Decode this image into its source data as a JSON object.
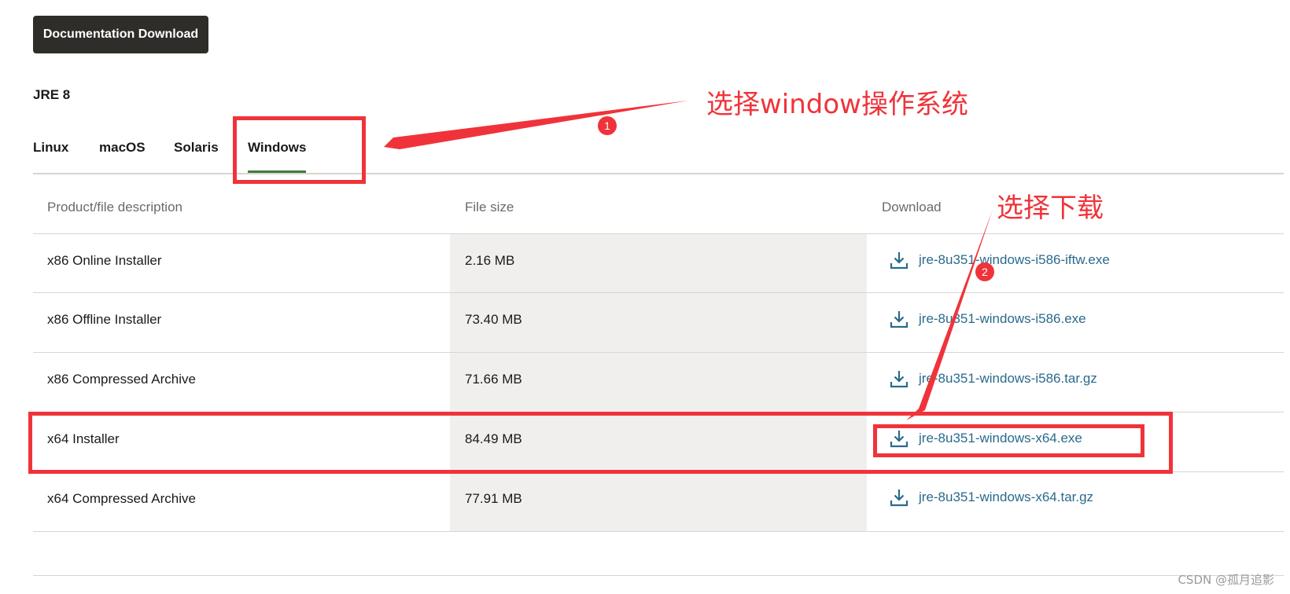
{
  "header": {
    "doc_button": "Documentation Download"
  },
  "section": {
    "title": "JRE 8"
  },
  "tabs": [
    {
      "label": "Linux",
      "active": false
    },
    {
      "label": "macOS",
      "active": false
    },
    {
      "label": "Solaris",
      "active": false
    },
    {
      "label": "Windows",
      "active": true
    }
  ],
  "table": {
    "headers": [
      "Product/file description",
      "File size",
      "Download"
    ],
    "rows": [
      {
        "description": "x86 Online Installer",
        "size": "2.16 MB",
        "file": "jre-8u351-windows-i586-iftw.exe"
      },
      {
        "description": "x86 Offline Installer",
        "size": "73.40 MB",
        "file": "jre-8u351-windows-i586.exe"
      },
      {
        "description": "x86 Compressed Archive",
        "size": "71.66 MB",
        "file": "jre-8u351-windows-i586.tar.gz"
      },
      {
        "description": "x64 Installer",
        "size": "84.49 MB",
        "file": "jre-8u351-windows-x64.exe"
      },
      {
        "description": "x64 Compressed Archive",
        "size": "77.91 MB",
        "file": "jre-8u351-windows-x64.tar.gz"
      }
    ]
  },
  "annotations": {
    "note1": "选择window操作系统",
    "note2": "选择下载",
    "badge1": "1",
    "badge2": "2"
  },
  "watermark": "CSDN @孤月追影",
  "colors": {
    "accent_red": "#f0333a",
    "link": "#2a6a8c",
    "tab_underline": "#3d7a3d",
    "button_bg": "#2f2d2a"
  },
  "icons": {
    "download": "download-icon"
  }
}
